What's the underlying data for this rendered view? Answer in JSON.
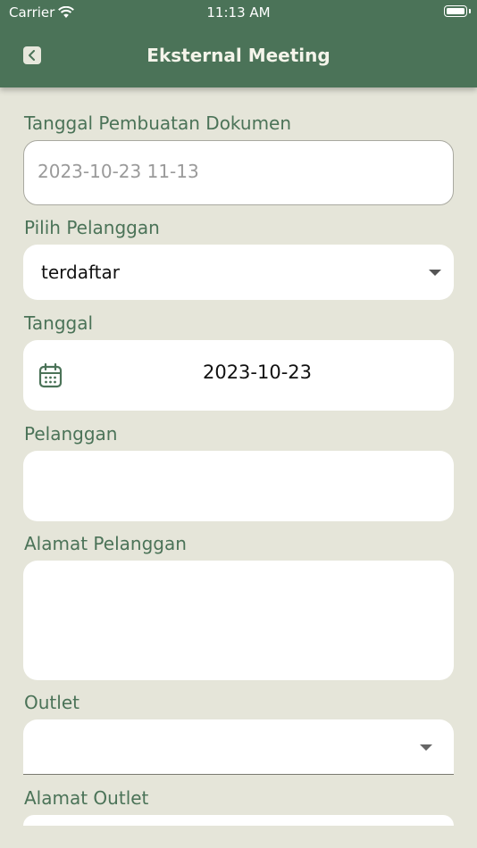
{
  "status_bar": {
    "carrier": "Carrier",
    "time": "11:13 AM"
  },
  "header": {
    "title": "Eksternal Meeting",
    "back_icon": "chevron-left-icon"
  },
  "form": {
    "tanggal_pembuatan": {
      "label": "Tanggal Pembuatan Dokumen",
      "value": "2023-10-23 11-13"
    },
    "pilih_pelanggan": {
      "label": "Pilih Pelanggan",
      "value": "terdaftar"
    },
    "tanggal": {
      "label": "Tanggal",
      "value": "2023-10-23"
    },
    "pelanggan": {
      "label": "Pelanggan",
      "value": ""
    },
    "alamat_pelanggan": {
      "label": "Alamat Pelanggan",
      "value": ""
    },
    "outlet": {
      "label": "Outlet",
      "value": ""
    },
    "alamat_outlet": {
      "label": "Alamat Outlet",
      "value": ""
    }
  },
  "colors": {
    "primary": "#4b7358",
    "background": "#e5e5d9",
    "field": "#ffffff"
  }
}
